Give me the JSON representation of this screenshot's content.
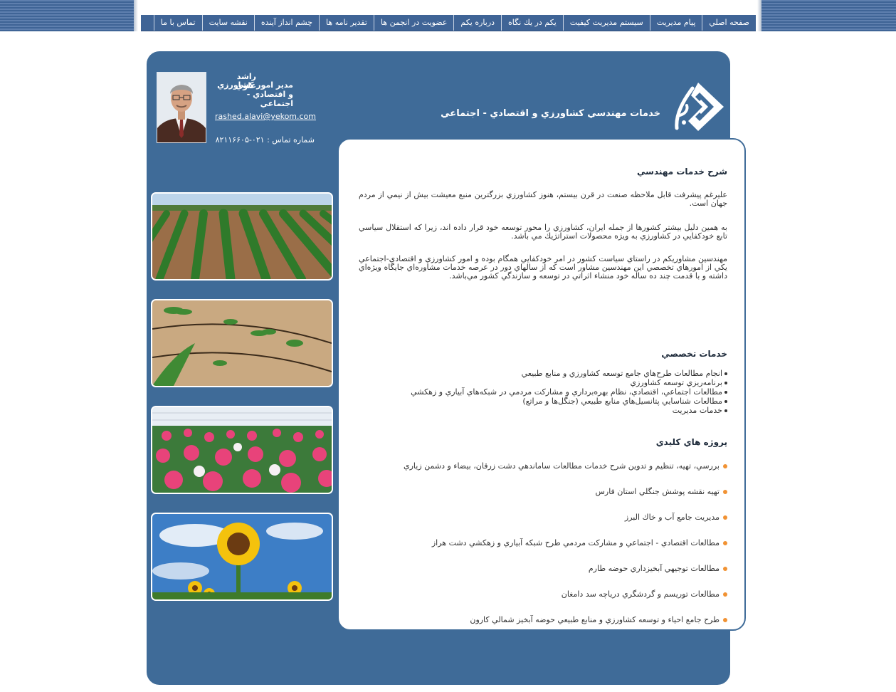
{
  "nav": {
    "items": [
      "صفحه اصلي",
      "پيام مديريت",
      "سيستم مديريت كيفيت",
      "يكم در يك نگاه",
      "درباره يكم",
      "عضويت در انجمن ها",
      "تقدير نامه ها",
      "چشم انداز آينده",
      "نقشه سايت",
      "تماس با ما"
    ]
  },
  "header": {
    "title": "خدمات مهندسي كشاورزي و اقتصادي - اجتماعي"
  },
  "profile": {
    "name": "راشد علوي",
    "title": "مدير امور كشاورزي و اقتصادي - اجتماعي",
    "email": "rashed.alavi@yekom.com",
    "phone": "شماره تماس : ۰۲۱-۸۲۱۱۶۶۰۵"
  },
  "content": {
    "intro_heading": "شرح خدمات مهندسي",
    "paragraphs": [
      "عليرغم پيشرفت قابل ملاحظه صنعت در قرن بيستم، هنوز كشاورزي بزرگترين منبع معيشت بيش از نيمي از مردم جهان است.",
      "به همين دليل بيشتر كشورها از جمله ايران، كشاورزي را محور توسعه خود قرار داده اند، زيرا كه استقلال سياسي تابع خودكفايي در كشاورزي به ويژه محصولات استراتژيك مي باشد.",
      "مهندسين مشاوريكم در راستاي سياست كشور در امر خودكفايي همگام بوده و امور كشاورزي و اقتصادي-اجتماعي يكي از امورهاي تخصصي اين مهندسين مشاور است كه از سالهاي دور در عرصه خدمات مشاوره‌اي جايگاه ويژه‌اي داشته و با قدمت چند ده ساله خود منشاء اثراتي در توسعه و سازندگي كشور مي‌باشد."
    ],
    "services_heading": "خدمات تخصصي",
    "services": [
      "انجام مطالعات طرح‌هاي جامع توسعه كشاورزي و منابع طبيعي",
      "برنامه‌ريزي توسعه كشاورزي",
      "مطالعات اجتماعي، اقتصادي، نظام بهره‌برداري و مشاركت مردمي در شبكه‌هاي آبياري و زهكشي",
      "مطالعات شناسايي پتانسيل‌هاي منابع طبيعي (جنگل‌ها و مراتع)",
      "خدمات مديريت"
    ],
    "projects_heading": "پروژه هاي كليدي",
    "projects": [
      "بررسي، تهيه، تنظيم و تدوين شرح خدمات مطالعات ساماندهي دشت زرقان، بيضاء و دشمن زياري",
      "تهيه نقشه پوشش جنگلي استان فارس",
      "مديريت جامع آب و خاك البرز",
      "مطالعات اقتصادي - اجتماعي و مشاركت مردمي طرح شبكه آبياري و زهكشي دشت هراز",
      "مطالعات توجيهي آبخيزداري حوضه طارم",
      "مطالعات توريسم و گردشگري درياچه سد دامغان",
      "طرح جامع احياء و توسعه كشاورزي و منابع طبيعي حوضه آبخيز شمالي كارون"
    ]
  },
  "photos": [
    "field-rows-photo",
    "banana-seedlings-photo",
    "cyclamen-greenhouse-photo",
    "sunflower-photo"
  ],
  "colors": {
    "panel_blue": "#3f6b98",
    "nav_blue": "#3f6496",
    "bullet_orange": "#f19233"
  }
}
